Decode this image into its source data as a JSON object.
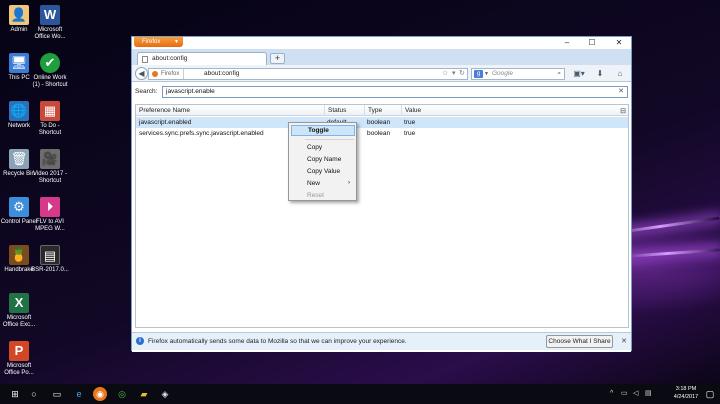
{
  "desktop": {
    "icons": [
      {
        "label": "Admin",
        "glyph": "👤"
      },
      {
        "label": "Microsoft Office Wo...",
        "glyph": "W"
      },
      {
        "label": "This PC",
        "glyph": "🖥"
      },
      {
        "label": "Online Work (1) - Shortcut",
        "glyph": "✔"
      },
      {
        "label": "Network",
        "glyph": "🌐"
      },
      {
        "label": "To Do - Shortcut",
        "glyph": "▦"
      },
      {
        "label": "Recycle Bin",
        "glyph": "🗑"
      },
      {
        "label": "Video 2017 - Shortcut",
        "glyph": "🎥"
      },
      {
        "label": "Control Panel",
        "glyph": "⚙"
      },
      {
        "label": "FLV to AVI MPEG W...",
        "glyph": "⏵"
      },
      {
        "label": "Handbrake",
        "glyph": "🍍"
      },
      {
        "label": "BSR-2017.0...",
        "glyph": "▤"
      },
      {
        "label": "Microsoft Office Exc...",
        "glyph": "X"
      },
      {
        "label": "Microsoft Office Po...",
        "glyph": "P"
      }
    ]
  },
  "browser": {
    "menu_button": "Firefox",
    "tab_title": "about:config",
    "url_identity": "Firefox",
    "url": "about:config",
    "search_engine": "Google",
    "search_placeholder": "Google",
    "colors": {
      "firefox_orange": "#e86a10",
      "selection": "#cfe5fa",
      "info_blue": "#2a6fd0"
    }
  },
  "config": {
    "filter_label": "Search:",
    "filter_value": "javascript.enable",
    "columns": [
      "Preference Name",
      "Status",
      "Type",
      "Value"
    ],
    "rows": [
      {
        "name": "javascript.enabled",
        "status": "default",
        "type": "boolean",
        "value": "true",
        "selected": true
      },
      {
        "name": "services.sync.prefs.sync.javascript.enabled",
        "status": "",
        "type": "boolean",
        "value": "true",
        "selected": false
      }
    ]
  },
  "context_menu": {
    "items": [
      {
        "label": "Toggle",
        "highlighted": true,
        "disabled": false
      },
      {
        "label": "Copy",
        "highlighted": false,
        "disabled": false
      },
      {
        "label": "Copy Name",
        "highlighted": false,
        "disabled": false
      },
      {
        "label": "Copy Value",
        "highlighted": false,
        "disabled": false
      },
      {
        "label": "New",
        "highlighted": false,
        "disabled": false,
        "submenu": true
      },
      {
        "label": "Reset",
        "highlighted": false,
        "disabled": true
      }
    ]
  },
  "notification": {
    "message": "Firefox automatically sends some data to Mozilla so that we can improve your experience.",
    "button": "Choose What I Share"
  },
  "taskbar": {
    "time": "3:18 PM",
    "date": "4/24/2017"
  }
}
